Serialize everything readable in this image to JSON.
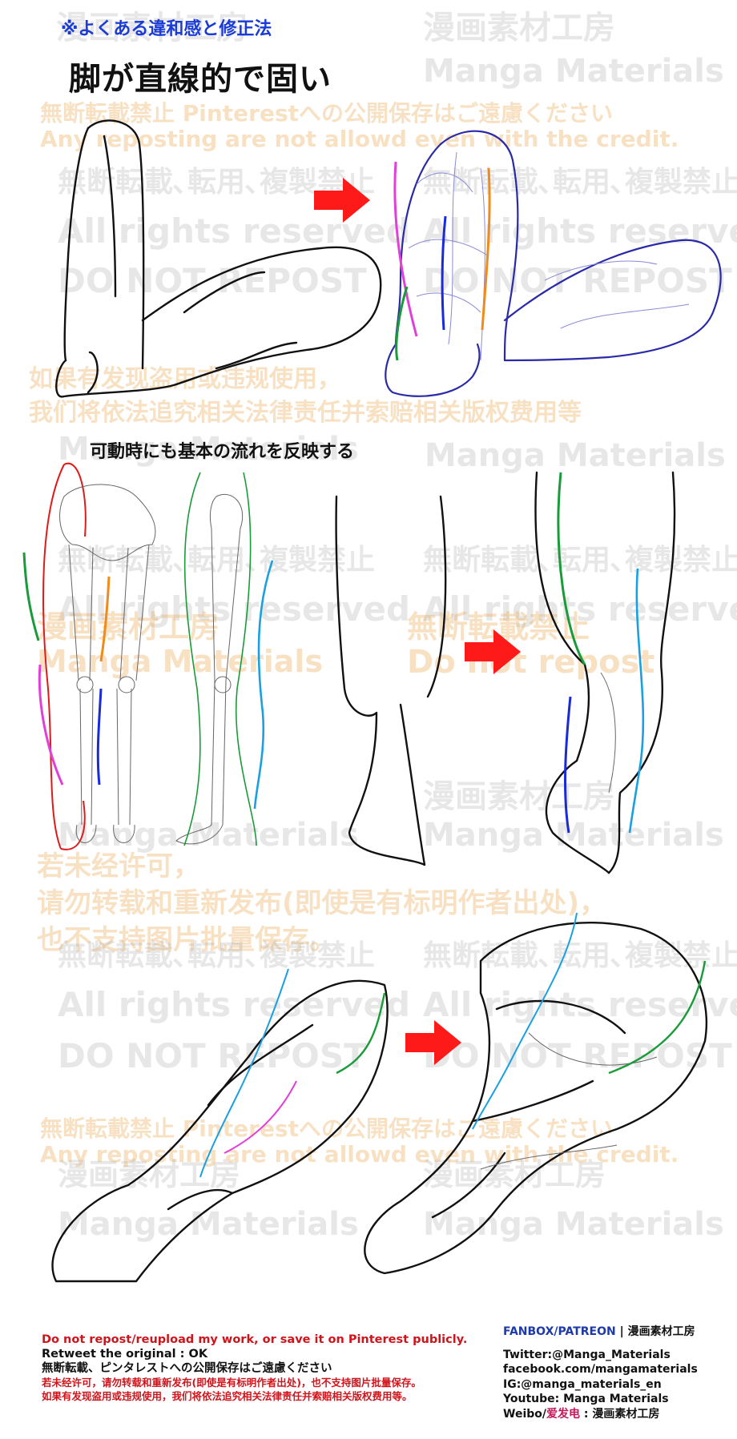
{
  "header": {
    "subtitle": "※よくある違和感と修正法",
    "title": "脚が直線的で固い"
  },
  "section_caption": "可動時にも基本の流れを反映する",
  "watermarks": {
    "studio_jp": "漫画素材工房",
    "studio_en": "Manga Materials",
    "no_pinterest_jp": "無断転載禁止 Pinterestへの公開保存はご遠慮ください",
    "no_repost_en": "Any reposting are not allowd even with the credit.",
    "no_reuse_jp": "無断転載､転用､複製禁止",
    "rights": "All rights reserved",
    "do_not_repost": "DO NOT REPOST",
    "cn_legal_1": "如果有发现盗用或违规使用，",
    "cn_legal_2": "我们将依法追究相关法律责任并索赔相关版权费用等",
    "no_repost_jp_short": "無断転載禁止",
    "do_not_repost_mixed": "Do not repost",
    "cn_permit_1": "若未经许可，",
    "cn_permit_2": "请勿转载和重新发布(即使是有标明作者出处)，",
    "cn_permit_3": "也不支持图片批量保存。"
  },
  "footer": {
    "left": {
      "line1": "Do not repost/reupload my work, or save it on Pinterest publicly.",
      "line2": "Retweet the original : OK",
      "line3": "無断転載、ピンタレストへの公開保存はご遠慮ください",
      "line4": "若未经许可，请勿转载和重新发布(即使是有标明作者出处)，也不支持图片批量保存。",
      "line5": "如果有发现盗用或违规使用，我们将依法追究相关法律责任并索赔相关版权费用等。"
    },
    "right": {
      "brand_prefix": "FANBOX/PATREON",
      "brand_sep": " | ",
      "brand_name": "漫画素材工房",
      "twitter": "Twitter:@Manga_Materials",
      "facebook": "facebook.com/mangamaterials",
      "instagram": "IG:@manga_materials_en",
      "youtube": "Youtube: Manga Materials",
      "weibo_prefix": "Weibo/",
      "weibo_handle": "爱发电",
      "weibo_sep": " : ",
      "weibo_name": "漫画素材工房"
    }
  },
  "colors": {
    "arrow_red": "#ff1a1a",
    "guide_green": "#1a9b3a",
    "guide_magenta": "#e040d8",
    "guide_orange": "#f08a1a",
    "guide_blue": "#1a2ad8",
    "guide_cyan": "#1aa0e0",
    "guide_red": "#e01a1a"
  },
  "icons": [
    "arrow-right-icon"
  ]
}
